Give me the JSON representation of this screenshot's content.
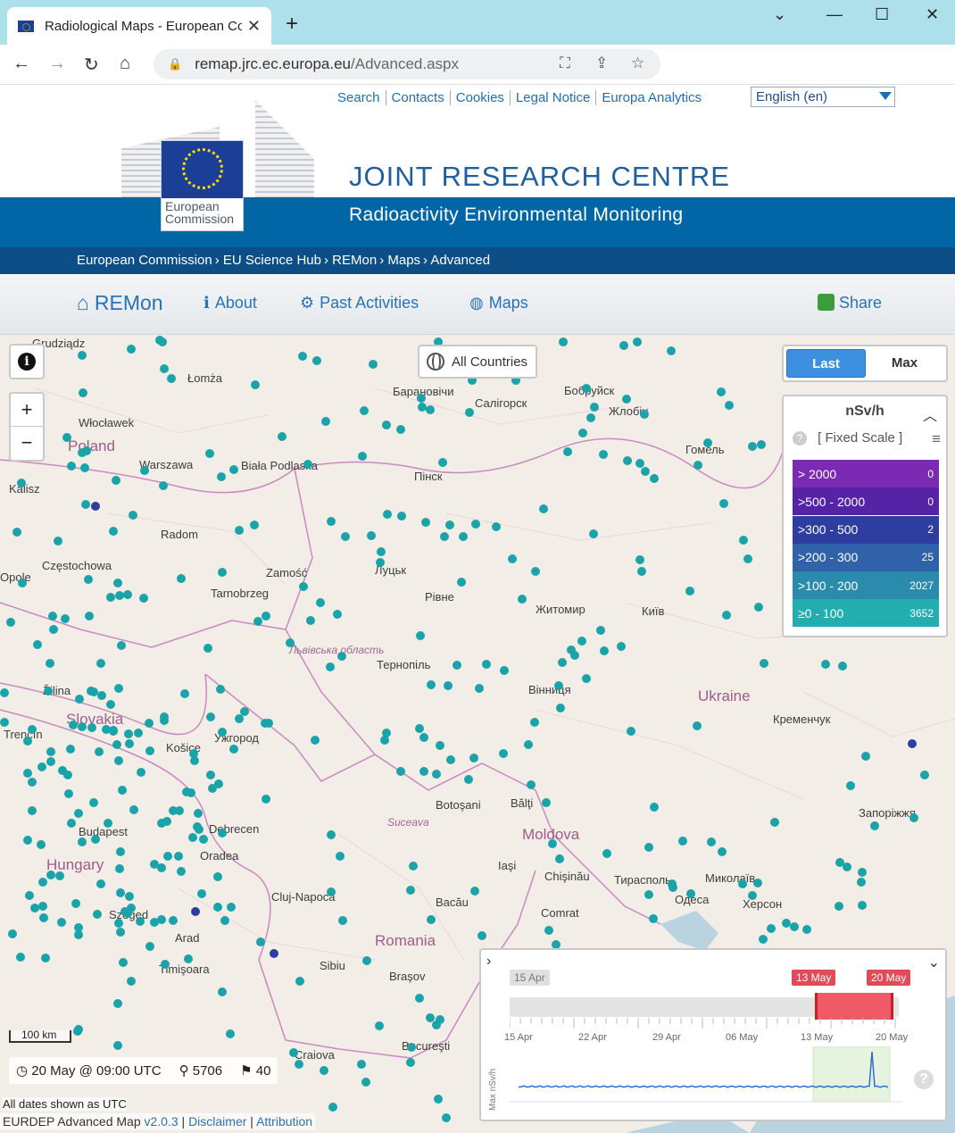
{
  "browser": {
    "tab_title": "Radiological Maps - European Co",
    "url_host": "remap.jrc.ec.europa.eu",
    "url_path": "/Advanced.aspx"
  },
  "header": {
    "links": [
      "Search",
      "Contacts",
      "Cookies",
      "Legal Notice",
      "Europa Analytics"
    ],
    "language": "English (en)",
    "logo_text_1": "European",
    "logo_text_2": "Commission",
    "jrc_title": "JOINT RESEARCH CENTRE",
    "band_title": "Radioactivity Environmental Monitoring",
    "breadcrumbs": [
      "European Commission",
      "EU Science Hub",
      "REMon",
      "Maps",
      "Advanced"
    ]
  },
  "menu": {
    "remon": "REMon",
    "about": "About",
    "past": "Past Activities",
    "maps": "Maps",
    "share": "Share"
  },
  "map": {
    "all_countries": "All Countries",
    "mode_last": "Last",
    "mode_max": "Max",
    "legend_title": "nSv/h",
    "fixed_scale": "[ Fixed Scale ]",
    "legend_rows": [
      {
        "label": "> 2000",
        "count": "0",
        "color": "#7b2bb3"
      },
      {
        "label": ">500 - 2000",
        "count": "0",
        "color": "#5524a6"
      },
      {
        "label": ">300 - 500",
        "count": "2",
        "color": "#2e3ea0"
      },
      {
        "label": ">200 - 300",
        "count": "25",
        "color": "#2f62a8"
      },
      {
        "label": ">100 - 200",
        "count": "2027",
        "color": "#2a8bad"
      },
      {
        "label": "≥0 - 100",
        "count": "3652",
        "color": "#22adb1"
      }
    ],
    "scale": "100 km",
    "status_time": "20 May @ 09:00 UTC",
    "status_stations": "5706",
    "status_countries": "40",
    "utc_note": "All dates shown as UTC",
    "footer_name": "EURDEP Advanced Map",
    "footer_version": "v2.0.3",
    "footer_disclaimer": "Disclaimer",
    "footer_attribution": "Attribution",
    "labels": {
      "poland": "Poland",
      "warszawa": "Warszawa",
      "ukraine": "Ukraine",
      "slovakia": "Slovakia",
      "hungary": "Hungary",
      "romania": "Romania",
      "moldova": "Moldova",
      "kyiv": "Київ",
      "chisinau": "Chişinău",
      "lomza": "Łomża",
      "wloclawek": "Włocławek",
      "radom": "Radom",
      "czestochowa": "Częstochowa",
      "zamosc": "Zamość",
      "lutsk": "Луцьк",
      "rivne": "Рівне",
      "zhytomyr": "Житомир",
      "ternopil": "Тернопіль",
      "vinnytsia": "Вінниця",
      "pinsk": "Пінск",
      "baranovichi": "Барановічи",
      "salihorsk": "Салігорск",
      "babruisk": "Бобруйск",
      "zhlobin": "Жлобін",
      "gomel": "Гомель",
      "kremenchuk": "Кременчук",
      "zaporizhzhia": "Запоріжжя",
      "mykolaiv": "Миколаїв",
      "kherson": "Херсон",
      "odesa": "Одеса",
      "debrecen": "Debrecen",
      "oradea": "Oradea",
      "cluj": "Cluj-Napoca",
      "iasi": "Iaşi",
      "sibiu": "Sibiu",
      "brasov": "Braşov",
      "bucuresti": "Bucureşti",
      "craiova": "Craiova",
      "szeged": "Szeged",
      "kosice": "Košice",
      "uzhhorod": "Ужгород",
      "lviv_obl": "Львівська область",
      "biala": "Biała Podlaska",
      "kalisz": "Kalisz",
      "opole": "Opole",
      "tarnobrzeg": "Tarnobrzeg",
      "grudziadz": "Grudziądz",
      "zilina": "Žilina",
      "trencin": "Trenčín",
      "budapest": "Budapest",
      "balti": "Bălţi",
      "botosani": "Botoşani",
      "suceava": "Suceava",
      "timisoara": "Timişoara",
      "arad": "Arad",
      "bacau": "Bacău",
      "tiraspol": "Тирасполь",
      "comrat": "Comrat"
    }
  },
  "timeline": {
    "start_label": "15 Apr",
    "range_start": "13 May",
    "range_end": "20 May",
    "ticks": [
      "15 Apr",
      "22 Apr",
      "29 Apr",
      "06 May",
      "13 May",
      "20 May"
    ],
    "y_label": "Max nSv/h"
  }
}
